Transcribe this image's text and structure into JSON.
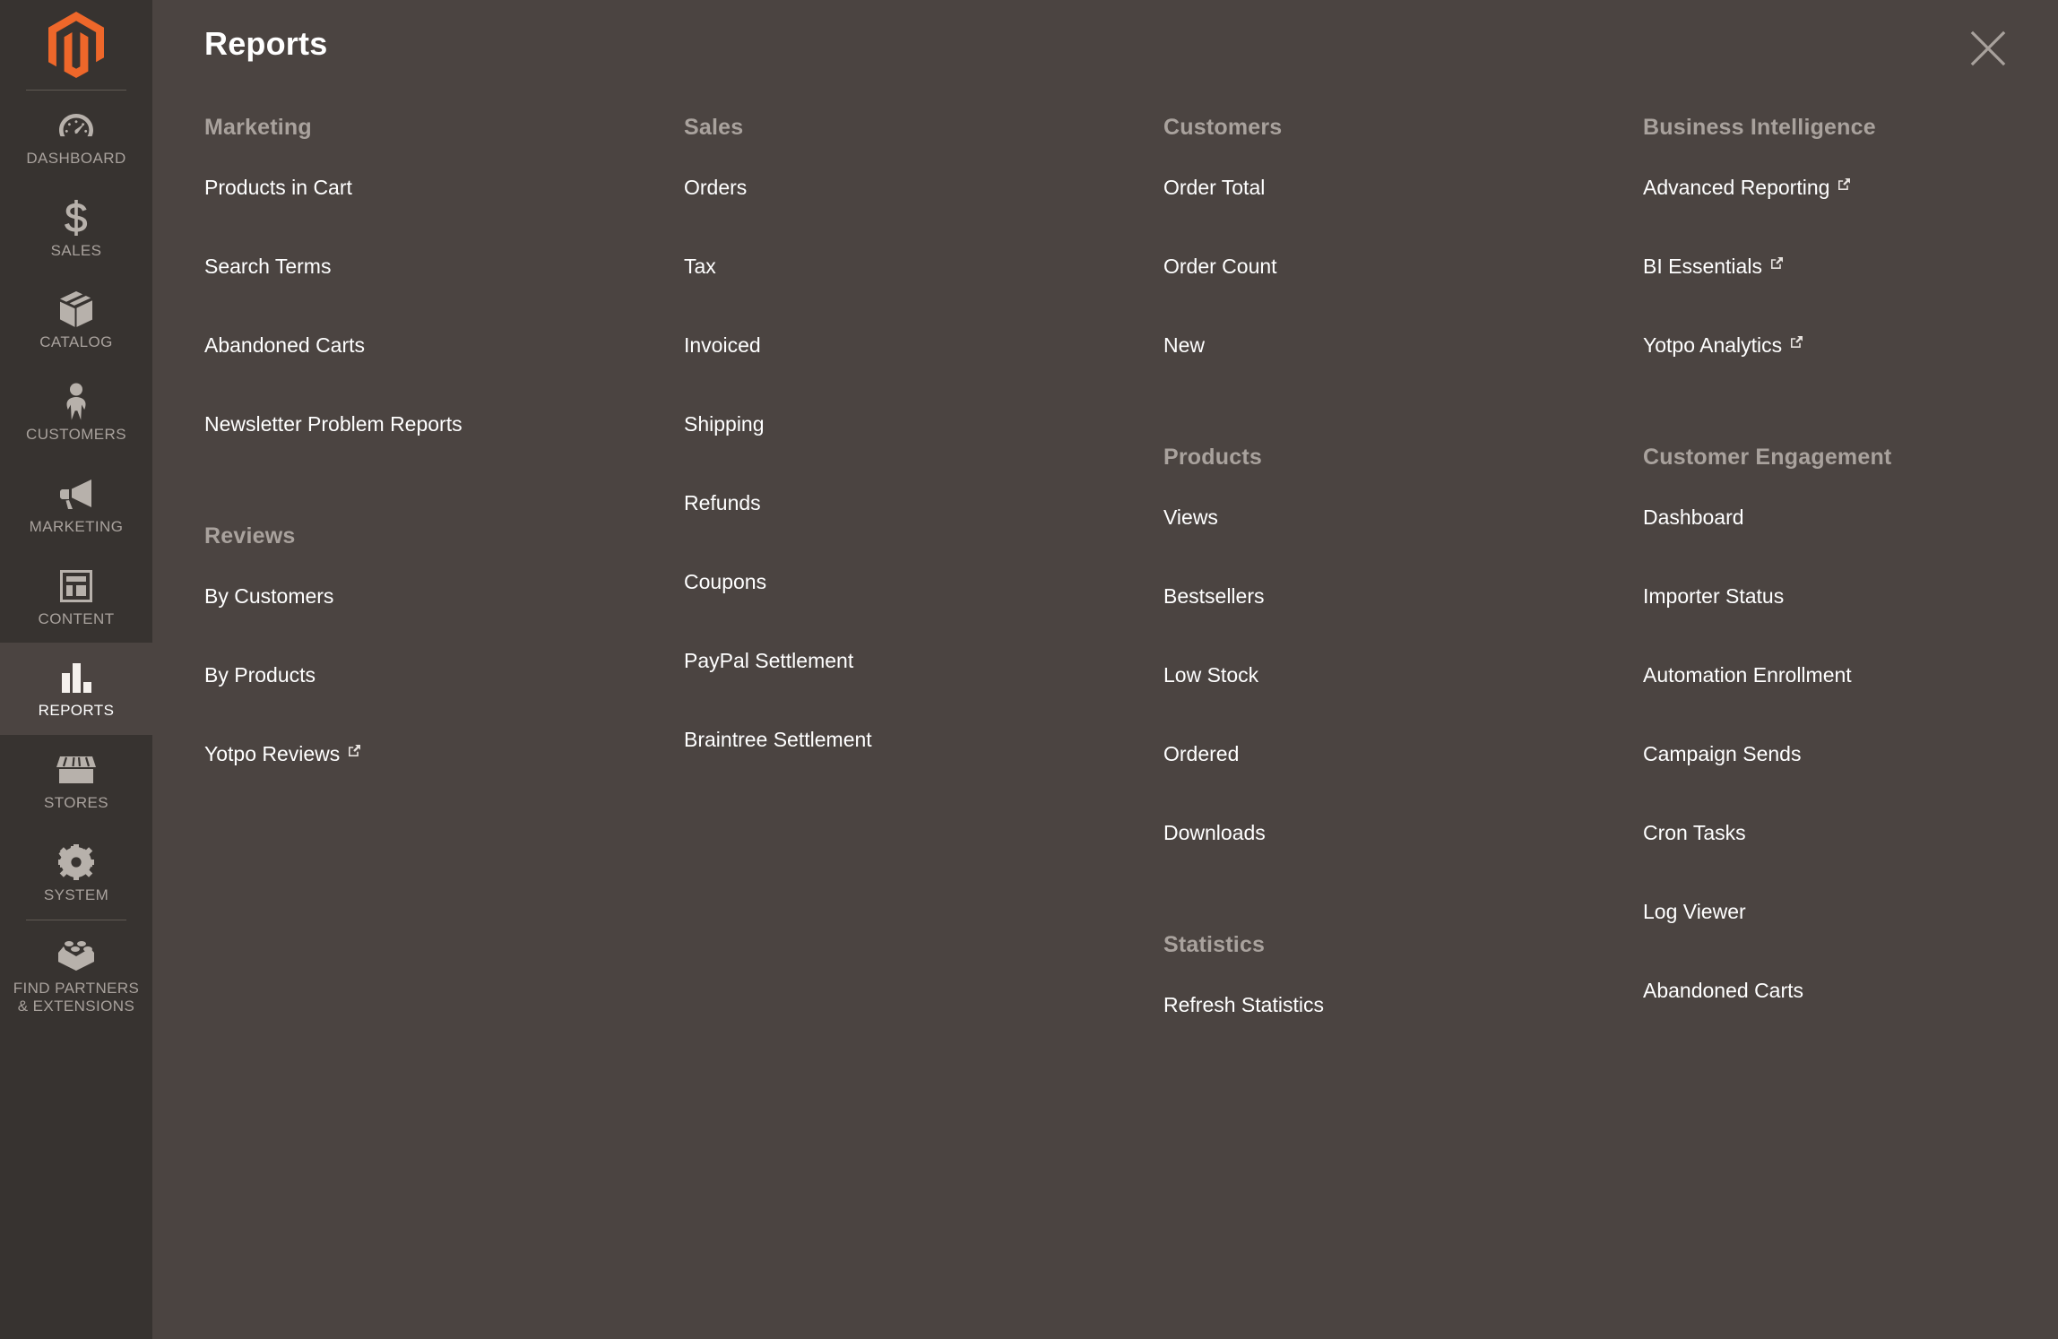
{
  "panel": {
    "title": "Reports",
    "close_label": "Close",
    "close_icon": "close-icon"
  },
  "sidebar": {
    "logo_icon": "magento-logo-icon",
    "items": [
      {
        "label": "DASHBOARD",
        "icon": "dashboard-gauge-icon",
        "active": false
      },
      {
        "label": "SALES",
        "icon": "dollar-sign-icon",
        "active": false
      },
      {
        "label": "CATALOG",
        "icon": "box-icon",
        "active": false
      },
      {
        "label": "CUSTOMERS",
        "icon": "person-icon",
        "active": false
      },
      {
        "label": "MARKETING",
        "icon": "megaphone-icon",
        "active": false
      },
      {
        "label": "CONTENT",
        "icon": "layout-icon",
        "active": false
      },
      {
        "label": "REPORTS",
        "icon": "bar-chart-icon",
        "active": true
      },
      {
        "label": "STORES",
        "icon": "storefront-icon",
        "active": false
      },
      {
        "label": "SYSTEM",
        "icon": "gear-icon",
        "active": false
      },
      {
        "label": "FIND PARTNERS\n& EXTENSIONS",
        "icon": "lego-brick-icon",
        "active": false
      }
    ]
  },
  "columns": [
    {
      "groups": [
        {
          "title": "Marketing",
          "items": [
            {
              "label": "Products in Cart",
              "external": false
            },
            {
              "label": "Search Terms",
              "external": false
            },
            {
              "label": "Abandoned Carts",
              "external": false
            },
            {
              "label": "Newsletter Problem Reports",
              "external": false
            }
          ]
        },
        {
          "title": "Reviews",
          "items": [
            {
              "label": "By Customers",
              "external": false
            },
            {
              "label": "By Products",
              "external": false
            },
            {
              "label": "Yotpo Reviews",
              "external": true
            }
          ]
        }
      ]
    },
    {
      "groups": [
        {
          "title": "Sales",
          "items": [
            {
              "label": "Orders",
              "external": false
            },
            {
              "label": "Tax",
              "external": false
            },
            {
              "label": "Invoiced",
              "external": false
            },
            {
              "label": "Shipping",
              "external": false
            },
            {
              "label": "Refunds",
              "external": false
            },
            {
              "label": "Coupons",
              "external": false
            },
            {
              "label": "PayPal Settlement",
              "external": false
            },
            {
              "label": "Braintree Settlement",
              "external": false
            }
          ]
        }
      ]
    },
    {
      "groups": [
        {
          "title": "Customers",
          "items": [
            {
              "label": "Order Total",
              "external": false
            },
            {
              "label": "Order Count",
              "external": false
            },
            {
              "label": "New",
              "external": false
            }
          ]
        },
        {
          "title": "Products",
          "items": [
            {
              "label": "Views",
              "external": false
            },
            {
              "label": "Bestsellers",
              "external": false
            },
            {
              "label": "Low Stock",
              "external": false
            },
            {
              "label": "Ordered",
              "external": false
            },
            {
              "label": "Downloads",
              "external": false
            }
          ]
        },
        {
          "title": "Statistics",
          "items": [
            {
              "label": "Refresh Statistics",
              "external": false
            }
          ]
        }
      ]
    },
    {
      "groups": [
        {
          "title": "Business Intelligence",
          "items": [
            {
              "label": "Advanced Reporting",
              "external": true
            },
            {
              "label": "BI Essentials",
              "external": true
            },
            {
              "label": "Yotpo Analytics",
              "external": true
            }
          ]
        },
        {
          "title": "Customer Engagement",
          "items": [
            {
              "label": "Dashboard",
              "external": false
            },
            {
              "label": "Importer Status",
              "external": false
            },
            {
              "label": "Automation Enrollment",
              "external": false
            },
            {
              "label": "Campaign Sends",
              "external": false
            },
            {
              "label": "Cron Tasks",
              "external": false
            },
            {
              "label": "Log Viewer",
              "external": false
            },
            {
              "label": "Abandoned Carts",
              "external": false
            }
          ]
        }
      ]
    }
  ],
  "colors": {
    "sidebar_bg": "#373330",
    "panel_bg": "#4b4441",
    "accent_orange": "#ee672a",
    "group_title": "#a9a29d",
    "link_text": "#ffffff"
  }
}
